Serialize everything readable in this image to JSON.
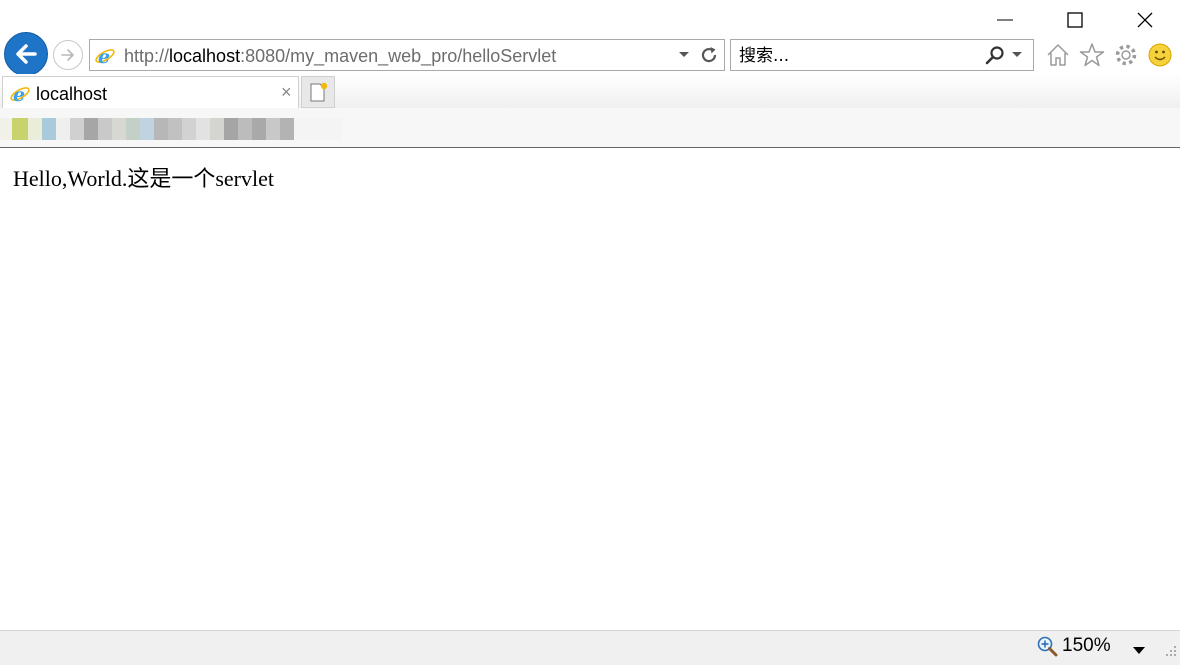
{
  "browser": {
    "address": {
      "scheme": "http://",
      "host": "localhost",
      "rest": ":8080/my_maven_web_pro/helloServlet"
    },
    "search": {
      "placeholder": "搜索..."
    },
    "tab": {
      "title": "localhost",
      "close": "×"
    },
    "icons": {
      "back": "back-arrow-icon",
      "forward": "forward-arrow-icon",
      "ie": "internet-explorer-icon",
      "refresh": "refresh-icon",
      "search": "magnifier-icon",
      "home": "home-icon",
      "favorites": "star-icon",
      "settings": "gear-icon",
      "feedback": "smiley-icon",
      "new_tab": "new-tab-icon",
      "zoom": "zoom-in-icon"
    },
    "colors": {
      "accent": "#1e74c6",
      "ie_blue": "#3aa0e8",
      "ie_gold": "#f2b90c"
    }
  },
  "page": {
    "text": "Hello,World.这是一个servlet"
  },
  "statusbar": {
    "zoom": "150%"
  }
}
